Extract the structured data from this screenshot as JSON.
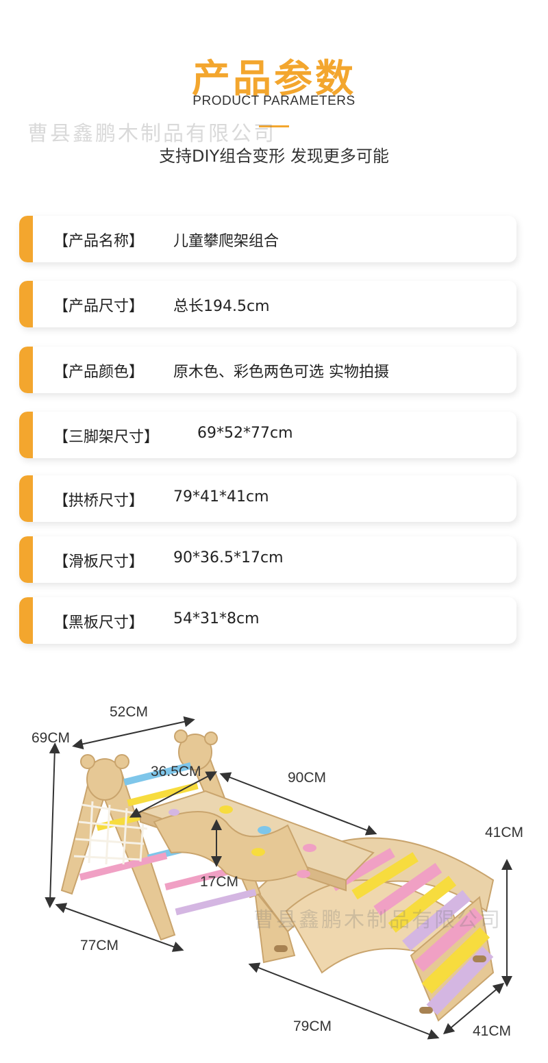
{
  "header": {
    "title": "产品参数",
    "subtitle": "PRODUCT PARAMETERS",
    "tagline": "支持DIY组合变形 发现更多可能"
  },
  "watermark": "曹县鑫鹏木制品有限公司",
  "params": [
    {
      "label": "【产品名称】",
      "value": "儿童攀爬架组合"
    },
    {
      "label": "【产品尺寸】",
      "value": "总长194.5cm"
    },
    {
      "label": "【产品颜色】",
      "value": "原木色、彩色两色可选 实物拍摄"
    },
    {
      "label": "【三脚架尺寸】",
      "value": "69*52*77cm"
    },
    {
      "label": "【拱桥尺寸】",
      "value": "79*41*41cm"
    },
    {
      "label": "【滑板尺寸】",
      "value": "90*36.5*17cm"
    },
    {
      "label": "【黑板尺寸】",
      "value": "54*31*8cm"
    }
  ],
  "dimensions": {
    "d52": "52CM",
    "d69": "69CM",
    "d365": "36.5CM",
    "d90": "90CM",
    "d41a": "41CM",
    "d17": "17CM",
    "d77": "77CM",
    "d79": "79CM",
    "d41b": "41CM"
  },
  "colors": {
    "accent": "#f3a62e",
    "wood": "#e8c99a",
    "rung_blue": "#7ec6ea",
    "rung_yellow": "#f7dc3e",
    "rung_pink": "#f0a0c4",
    "rung_purple": "#d4b6e2"
  }
}
